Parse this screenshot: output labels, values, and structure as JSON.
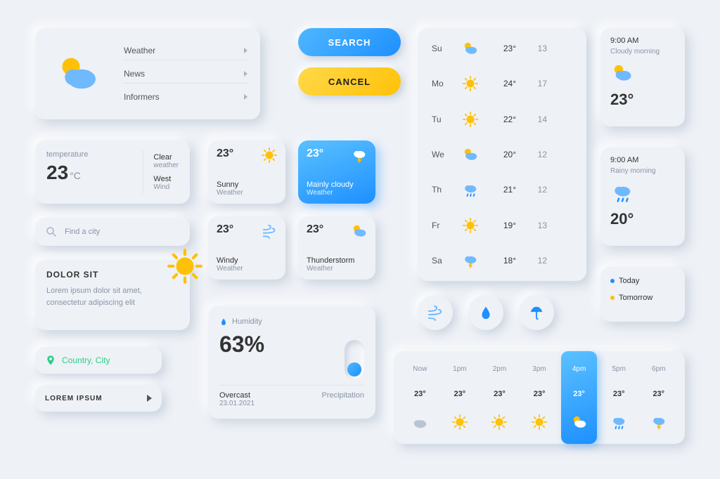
{
  "menu": {
    "items": [
      "Weather",
      "News",
      "Informers"
    ]
  },
  "buttons": {
    "search": "SEARCH",
    "cancel": "CANCEL"
  },
  "temp_card": {
    "label": "temperature",
    "value": "23",
    "unit": "°C",
    "cond1": "Clear",
    "cond1_sub": "weather",
    "cond2": "West",
    "cond2_sub": "Wind"
  },
  "minis": [
    {
      "temp": "23°",
      "title": "Sunny",
      "sub": "Weather",
      "icon": "sun"
    },
    {
      "temp": "23°",
      "title": "Mainly cloudy",
      "sub": "Weather",
      "icon": "storm"
    },
    {
      "temp": "23°",
      "title": "Windy",
      "sub": "Weather",
      "icon": "wind"
    },
    {
      "temp": "23°",
      "title": "Thunderstorm",
      "sub": "Weather",
      "icon": "partly"
    }
  ],
  "search": {
    "placeholder": "Find a city"
  },
  "info": {
    "title": "DOLOR SIT",
    "body": "Lorem ipsum dolor sit amet, consectetur adipiscing elit"
  },
  "location": {
    "text": "Country, City"
  },
  "lorem_btn": {
    "text": "LOREM IPSUM"
  },
  "humidity": {
    "label": "Humidity",
    "value": "63%",
    "cond": "Overcast",
    "precip": "Precipitation",
    "date": "23.01.2021"
  },
  "week": [
    {
      "day": "Su",
      "icon": "partly",
      "hi": "23°",
      "lo": "13"
    },
    {
      "day": "Mo",
      "icon": "sun",
      "hi": "24°",
      "lo": "17"
    },
    {
      "day": "Tu",
      "icon": "sun",
      "hi": "22°",
      "lo": "14"
    },
    {
      "day": "We",
      "icon": "partly",
      "hi": "20°",
      "lo": "12"
    },
    {
      "day": "Th",
      "icon": "rain",
      "hi": "21°",
      "lo": "12"
    },
    {
      "day": "Fr",
      "icon": "sun",
      "hi": "19°",
      "lo": "13"
    },
    {
      "day": "Sa",
      "icon": "storm",
      "hi": "18°",
      "lo": "12"
    }
  ],
  "side": [
    {
      "time": "9:00 AM",
      "sub": "Cloudy morning",
      "temp": "23°",
      "icon": "partly"
    },
    {
      "time": "9:00 AM",
      "sub": "Rainy morning",
      "temp": "20°",
      "icon": "rain"
    }
  ],
  "legend": {
    "a": "Today",
    "b": "Tomorrow"
  },
  "hourly": [
    {
      "t": "Now",
      "temp": "23°",
      "icon": "cloud"
    },
    {
      "t": "1pm",
      "temp": "23°",
      "icon": "sun"
    },
    {
      "t": "2pm",
      "temp": "23°",
      "icon": "sun"
    },
    {
      "t": "3pm",
      "temp": "23°",
      "icon": "sun"
    },
    {
      "t": "4pm",
      "temp": "23°",
      "icon": "partly",
      "active": true
    },
    {
      "t": "5pm",
      "temp": "23°",
      "icon": "rain"
    },
    {
      "t": "6pm",
      "temp": "23°",
      "icon": "storm"
    }
  ],
  "colors": {
    "blue": "#1e90ff",
    "yellow": "#ffc107",
    "green": "#2bcf88"
  }
}
